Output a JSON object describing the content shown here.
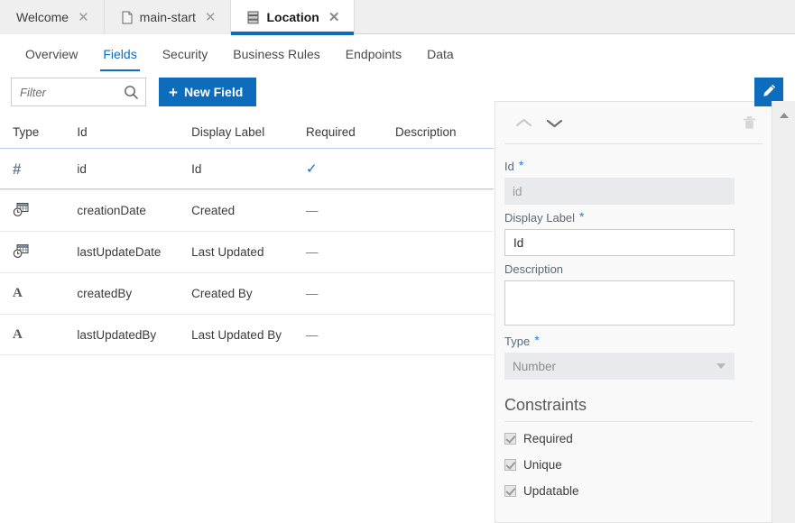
{
  "colors": {
    "accent": "#0d6cbb",
    "tabstrip_bg": "#efefef",
    "panel_bg": "#f9f9f9",
    "disabled_field": "#e9eaec",
    "required_star": "#2b7dd4"
  },
  "tabs": [
    {
      "label": "Welcome",
      "icon": "",
      "close": "✕",
      "active": false
    },
    {
      "label": "main-start",
      "icon": "document-icon",
      "close": "✕",
      "active": false
    },
    {
      "label": "Location",
      "icon": "database-icon",
      "close": "✕",
      "active": true
    }
  ],
  "subtabs": [
    {
      "label": "Overview",
      "active": false
    },
    {
      "label": "Fields",
      "active": true
    },
    {
      "label": "Security",
      "active": false
    },
    {
      "label": "Business Rules",
      "active": false
    },
    {
      "label": "Endpoints",
      "active": false
    },
    {
      "label": "Data",
      "active": false
    }
  ],
  "toolbar": {
    "filter_placeholder": "Filter",
    "filter_value": "",
    "search_icon": "search-icon",
    "new_field_label": "New Field",
    "new_field_plus": "+"
  },
  "table": {
    "headers": [
      "Type",
      "Id",
      "Display Label",
      "Required",
      "Description"
    ],
    "rows": [
      {
        "type_icon": "hash-icon",
        "type_glyph": "#",
        "id": "id",
        "label": "Id",
        "required": "✓",
        "description": "",
        "selected": true
      },
      {
        "type_icon": "calendar-clock-icon",
        "type_glyph": "",
        "id": "creationDate",
        "label": "Created",
        "required": "—",
        "description": "",
        "selected": false
      },
      {
        "type_icon": "calendar-clock-icon",
        "type_glyph": "",
        "id": "lastUpdateDate",
        "label": "Last Updated",
        "required": "—",
        "description": "",
        "selected": false
      },
      {
        "type_icon": "alpha-icon",
        "type_glyph": "A",
        "id": "createdBy",
        "label": "Created By",
        "required": "—",
        "description": "",
        "selected": false
      },
      {
        "type_icon": "alpha-icon",
        "type_glyph": "A",
        "id": "lastUpdatedBy",
        "label": "Last Updated By",
        "required": "—",
        "description": "",
        "selected": false
      }
    ]
  },
  "panel": {
    "nav_prev_icon": "chevron-up-icon",
    "nav_next_icon": "chevron-down-icon",
    "delete_icon": "trash-icon",
    "fields": {
      "id_label": "Id",
      "id_required": "*",
      "id_value": "id",
      "display_label_label": "Display Label",
      "display_label_required": "*",
      "display_label_value": "Id",
      "description_label": "Description",
      "description_value": "",
      "type_label": "Type",
      "type_required": "*",
      "type_value": "Number"
    },
    "constraints": {
      "title": "Constraints",
      "items": [
        {
          "label": "Required",
          "checked": true
        },
        {
          "label": "Unique",
          "checked": true
        },
        {
          "label": "Updatable",
          "checked": true
        }
      ]
    }
  },
  "edit_fab": {
    "icon": "pencil-icon",
    "title": "Edit"
  },
  "scrollbar": {
    "up_icon": "scroll-up-icon"
  }
}
